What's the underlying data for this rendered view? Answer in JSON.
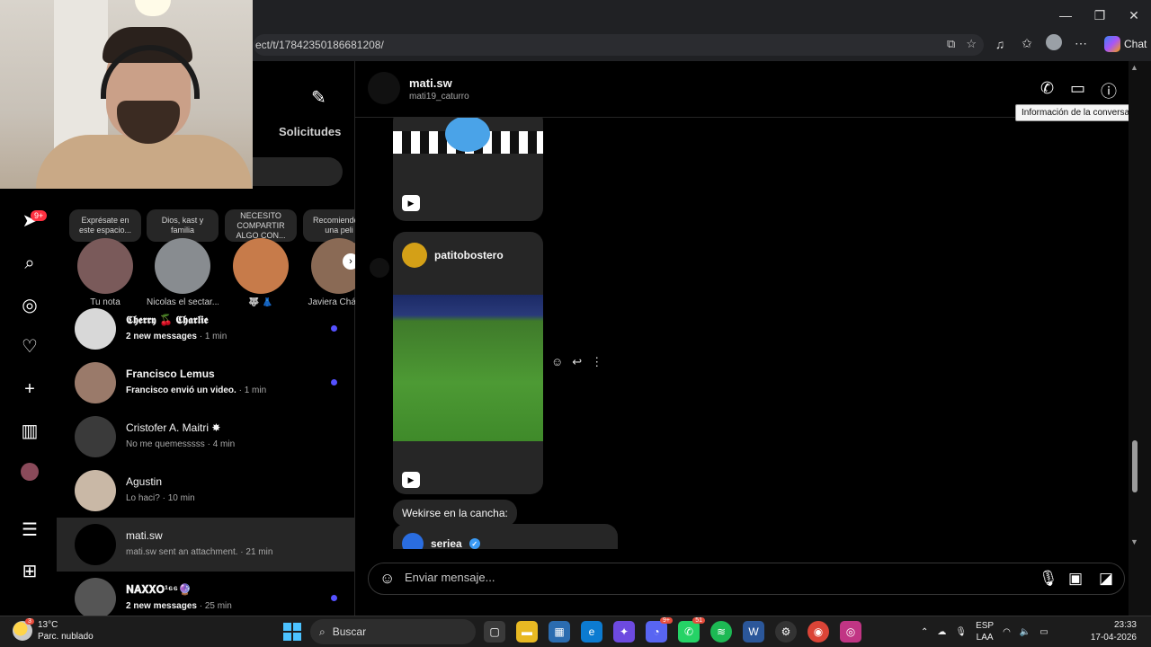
{
  "browser": {
    "url": "ect/t/17842350186681208/",
    "chat_label": "Chat",
    "window_controls": [
      "—",
      "❐",
      "✕"
    ]
  },
  "inbox": {
    "requests_label": "Solicitudes",
    "notes": [
      {
        "bubble": "Exprésate en este espacio...",
        "name": "Tu nota",
        "avatar_color": "#7a5a5a"
      },
      {
        "bubble": "Dios, kast y familia",
        "name": "Nicolas el sectar...",
        "avatar_color": "#888c90"
      },
      {
        "bubble": "NECESITO COMPARTIR ALGO CON...",
        "name": "🐺 👗",
        "avatar_color": "#c77b4a"
      },
      {
        "bubble": "Recomiende e una peli",
        "name": "Javiera Chávez",
        "avatar_color": "#8a6a55"
      }
    ],
    "threads": [
      {
        "name": "𝕮𝖍𝖊𝖗𝖗𝖞 🍒 𝕮𝖍𝖆𝖗𝖑𝖎𝖊",
        "preview": "2 new messages",
        "time": " · 1 min",
        "unread": true,
        "avatar_color": "#d8d8d8"
      },
      {
        "name": "Francisco Lemus",
        "preview": "Francisco envió un video.",
        "time": " · 1 min",
        "unread": true,
        "avatar_color": "#9a7a6a"
      },
      {
        "name": "Cristofer A. Maitri ✸",
        "preview": "No me quemesssss",
        "time": " · 4 min",
        "unread": false,
        "avatar_color": "#3a3a3a"
      },
      {
        "name": "Agustin",
        "preview": "Lo haci?",
        "time": " · 10 min",
        "unread": false,
        "avatar_color": "#c9b8a6"
      },
      {
        "name": "mati.sw",
        "preview": "mati.sw sent an attachment.",
        "time": " · 21 min",
        "unread": false,
        "avatar_color": "#000000"
      },
      {
        "name": "𝐍𝐀𝐗𝐗𝐎¹⁶⁶🔮",
        "preview": "2 new messages",
        "time": " · 25 min",
        "unread": true,
        "avatar_color": "#555555"
      }
    ]
  },
  "conversation": {
    "name": "mati.sw",
    "username": "mati19_caturro",
    "tooltip": "Información de la conversación",
    "post_author": "patitobostero",
    "text_message": "Wekirse en la cancha:",
    "share_author": "seriea",
    "composer_placeholder": "Enviar mensaje..."
  },
  "rail": {
    "notification_badge": "9+"
  },
  "taskbar": {
    "temperature": "13°C",
    "condition": "Parc. nublado",
    "weather_badge": "3",
    "search_label": "Buscar",
    "lang_top": "ESP",
    "lang_bottom": "LAA",
    "time": "23:33",
    "date": "17-04-2026",
    "badges": {
      "discord": "9+",
      "whatsapp": "51"
    }
  }
}
